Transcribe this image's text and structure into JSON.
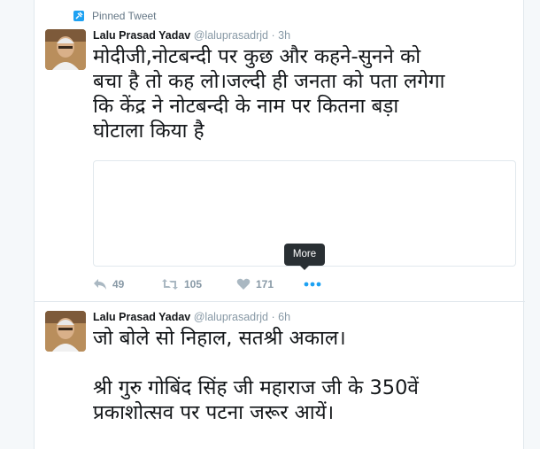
{
  "colors": {
    "background": "#f5f8fa",
    "card": "#ffffff",
    "border": "#e1e8ed",
    "muted": "#8899a6",
    "link_blue": "#1da1f2",
    "tooltip_bg": "#292f33"
  },
  "tweets": [
    {
      "pinned_label": "Pinned Tweet",
      "pinned_icon": "pin-icon",
      "author_name": "Lalu Prasad Yadav",
      "handle": "@laluprasadrjd",
      "separator": "·",
      "time": "3h",
      "text": "मोदीजी,नोटबन्दी पर कुछ और कहने-सुनने को\nबचा है तो कह लो।जल्दी ही जनता को पता लगेगा\nकि केंद्र ने नोटबन्दी के नाम पर कितना बड़ा\nघोटाला किया है",
      "actions": {
        "reply_icon": "reply-icon",
        "reply_count": "49",
        "retweet_icon": "retweet-icon",
        "retweet_count": "105",
        "like_icon": "heart-icon",
        "like_count": "171",
        "more_icon": "more-dots-icon",
        "more_tooltip": "More"
      }
    },
    {
      "author_name": "Lalu Prasad Yadav",
      "handle": "@laluprasadrjd",
      "separator": "·",
      "time": "6h",
      "text": "जो बोले सो निहाल, सतश्री अकाल।\n\nश्री गुरु गोबिंद सिंह जी महाराज जी के 350वें\nप्रकाशोत्सव पर पटना जरूर आयें।"
    }
  ]
}
